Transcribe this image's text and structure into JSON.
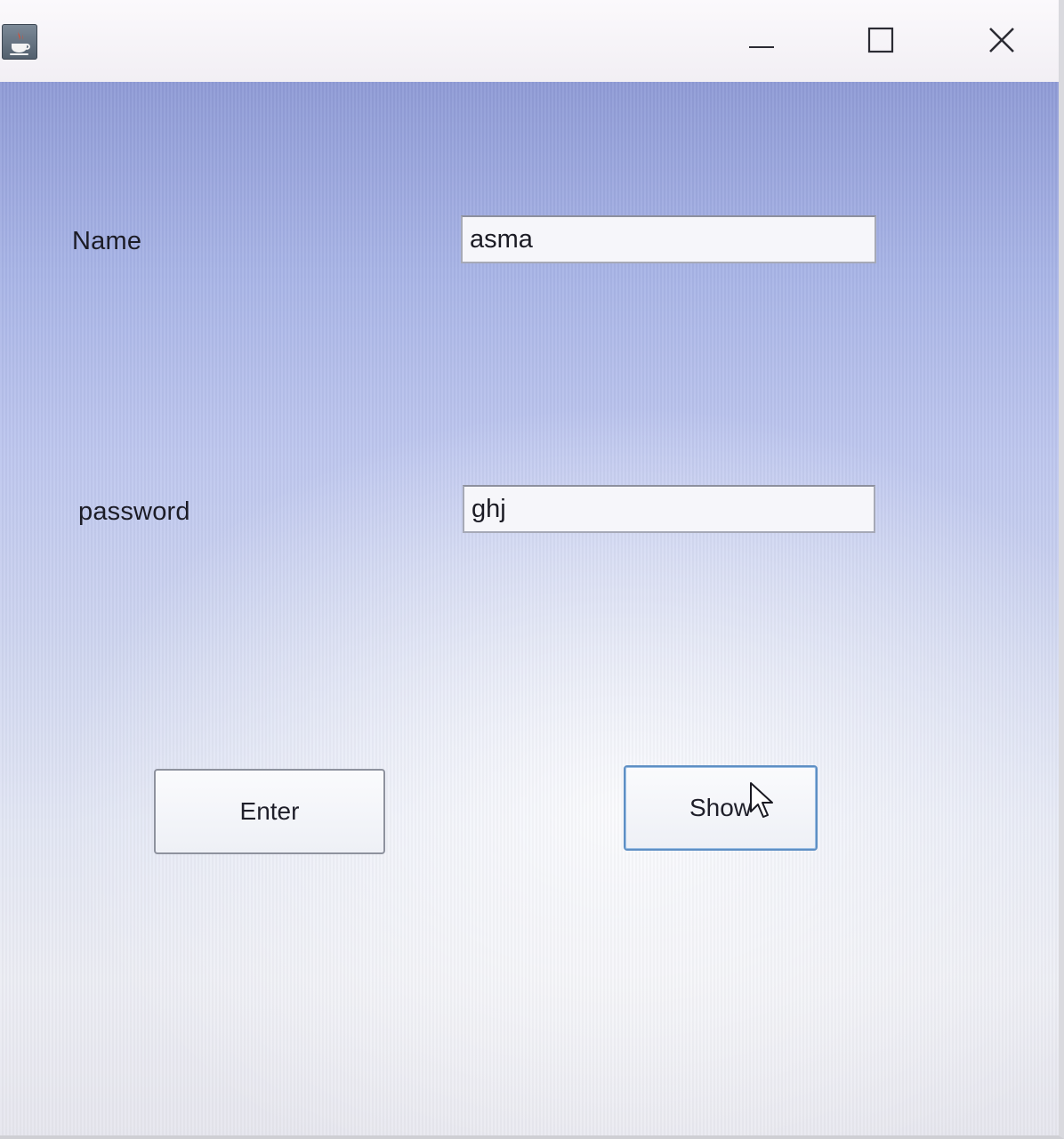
{
  "window": {
    "controls": {
      "minimize_icon": "minimize-icon",
      "maximize_icon": "maximize-icon",
      "close_icon": "close-icon"
    },
    "app_icon": "java-coffee-cup-icon"
  },
  "form": {
    "name_label": "Name",
    "name_value": "asma",
    "password_label": "password",
    "password_value": "ghj"
  },
  "buttons": {
    "enter_label": "Enter",
    "show_label": "Show"
  },
  "colors": {
    "background_top": "#8f9bd6",
    "background_bottom": "#e6e6ee",
    "focus_border": "#5e8fc4"
  }
}
